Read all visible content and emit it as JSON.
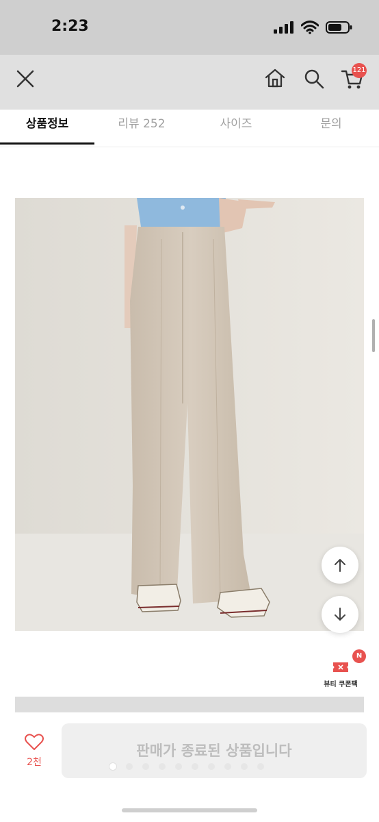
{
  "status_bar": {
    "time": "2:23"
  },
  "header": {
    "cart_count": "121"
  },
  "tabs": [
    {
      "label": "상품정보",
      "active": true
    },
    {
      "label": "리뷰 252",
      "active": false
    },
    {
      "label": "사이즈",
      "active": false
    },
    {
      "label": "문의",
      "active": false
    }
  ],
  "floating": {
    "coupon_label": "뷰티 쿠폰팩",
    "coupon_badge": "N"
  },
  "bottom": {
    "like_count": "2천",
    "soldout_label": "판매가 종료된 상품입니다"
  },
  "carousel": {
    "total": 10,
    "active_index": 0
  },
  "colors": {
    "accent": "#e8524f",
    "pants": "#d3c7b8",
    "shirt": "#8fb9dd"
  }
}
